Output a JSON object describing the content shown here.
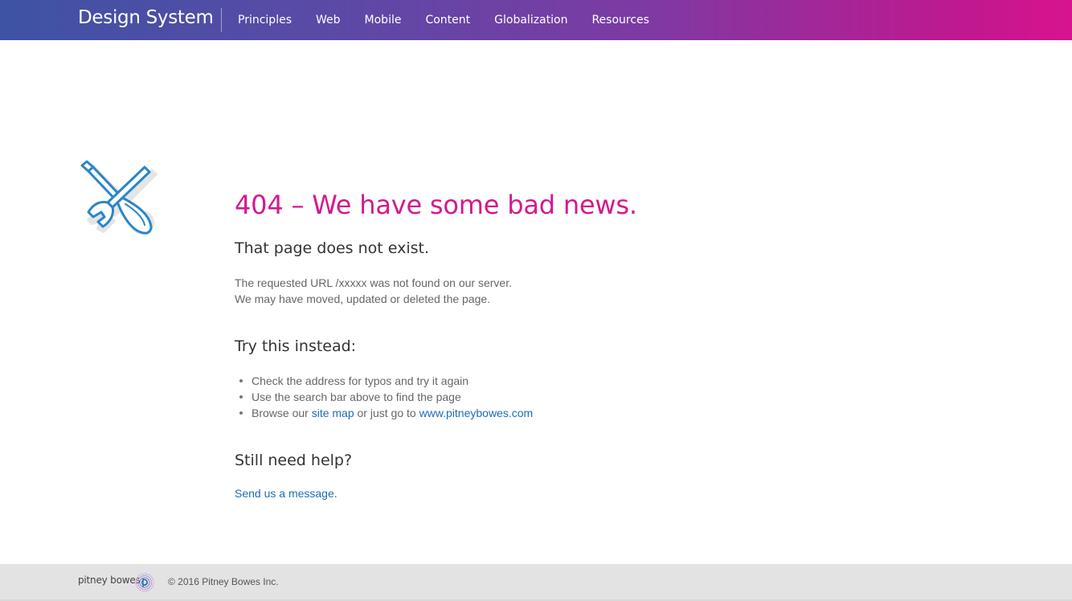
{
  "header": {
    "brand": "Design System",
    "nav": [
      "Principles",
      "Web",
      "Mobile",
      "Content",
      "Globalization",
      "Resources"
    ]
  },
  "hero": {
    "icon": "tools-icon"
  },
  "main": {
    "title": "404 – We have some bad news.",
    "subtitle": "That page does not exist.",
    "desc_line1": "The requested URL /xxxxx was not found on our server.",
    "desc_line2": "We may have moved, updated or deleted the page.",
    "try_heading": "Try this instead:",
    "tips": {
      "tip1": "Check the address for typos and try it again",
      "tip2": "Use the search bar above to find the page",
      "tip3_prefix": "Browse our ",
      "tip3_sitemap": "site map",
      "tip3_middle": " or just go to ",
      "tip3_url": "www.pitneybowes.com"
    },
    "help_heading": "Still need help?",
    "help_link": "Send us a message."
  },
  "footer": {
    "logo_text": "pitney bowes",
    "copyright": "© 2016 Pitney Bowes Inc."
  },
  "colors": {
    "accent_pink": "#d4198e",
    "link_blue": "#1b6db3",
    "icon_blue": "#2a86c9",
    "header_gradient_start": "#3e53a4",
    "header_gradient_end": "#d8138f"
  }
}
